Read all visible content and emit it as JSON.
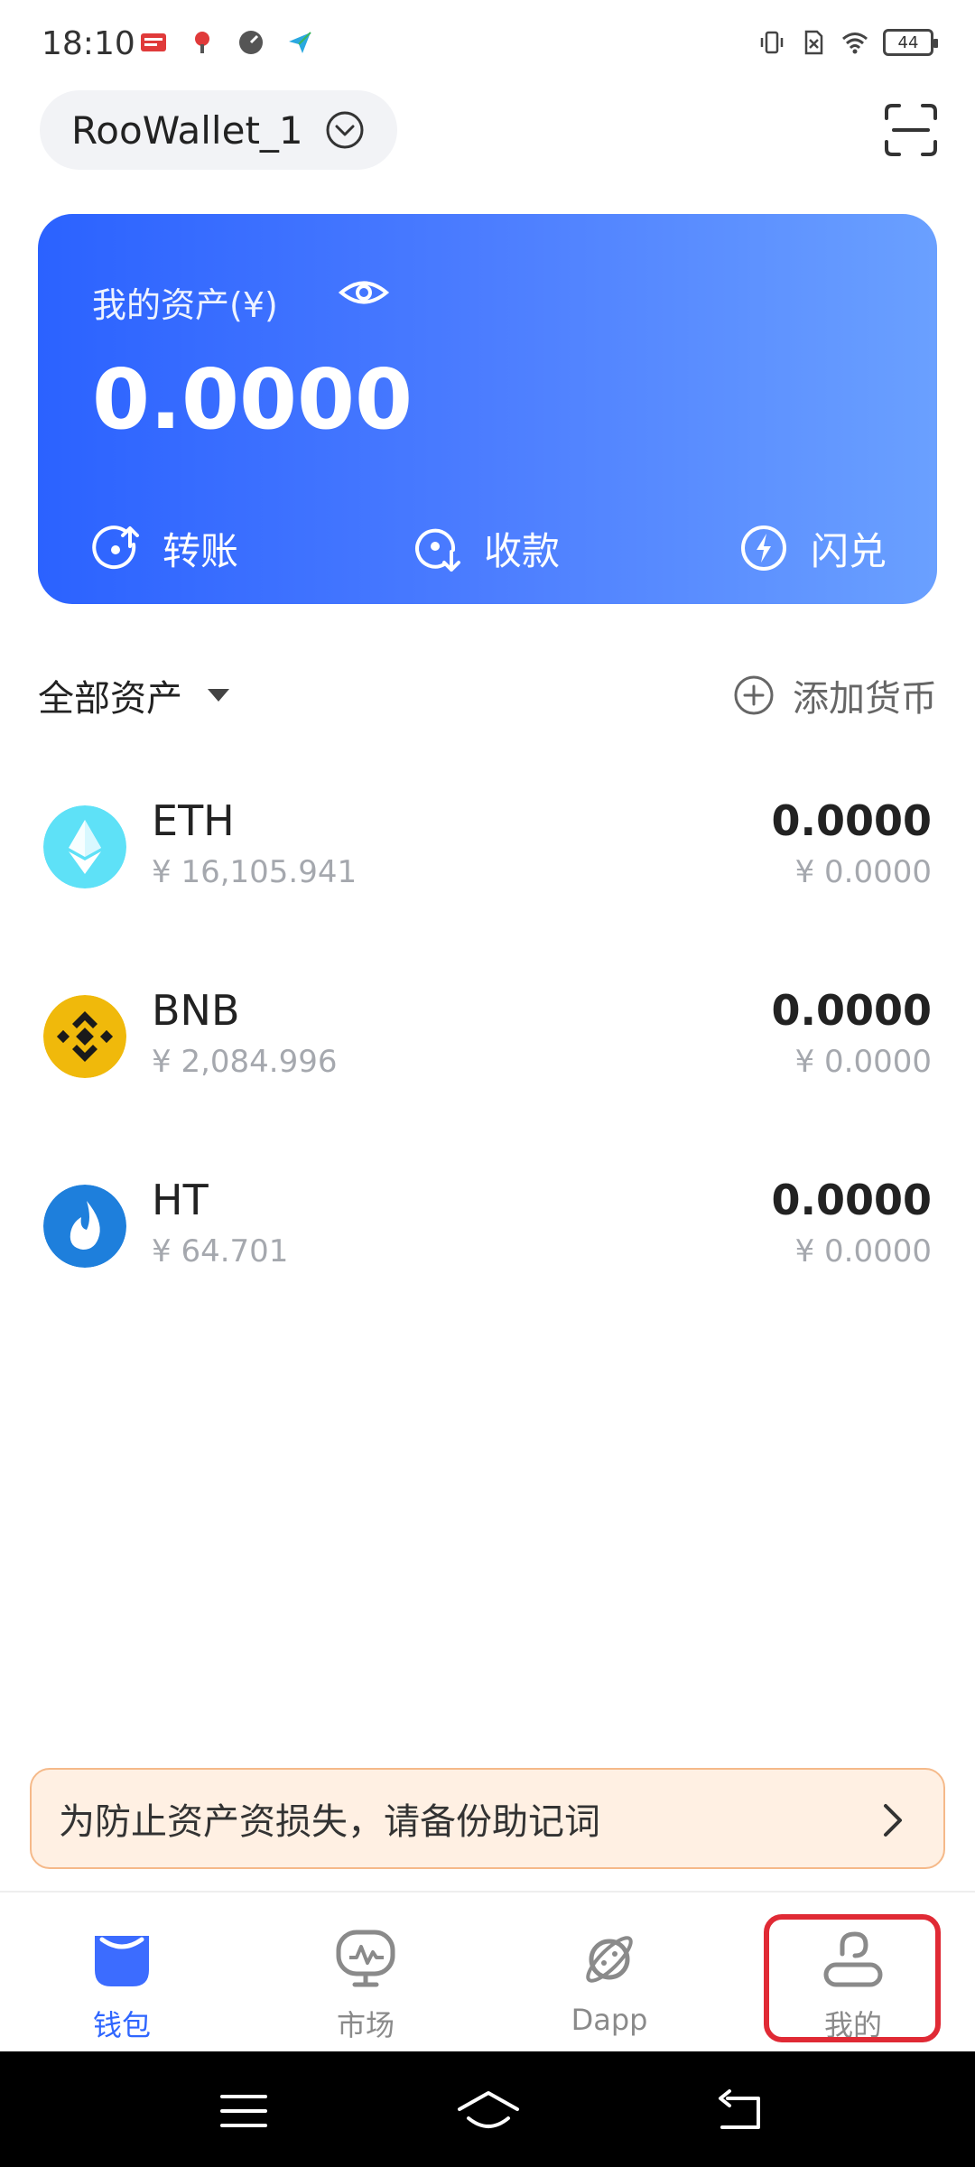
{
  "status_bar": {
    "time": "18:10",
    "battery": "44",
    "left_icons": [
      "toutiao-icon",
      "map-pin-icon",
      "speedometer-icon",
      "send-icon"
    ],
    "right_icons": [
      "vibrate-icon",
      "no-sim-icon",
      "wifi-icon",
      "battery-icon"
    ]
  },
  "header": {
    "wallet_name": "RooWallet_1",
    "chevron_icon": "chevron-down-circle-icon",
    "scan_icon": "scan-icon"
  },
  "asset_card": {
    "title": "我的资产(¥)",
    "total": "0.0000",
    "actions": [
      {
        "label": "转账",
        "icon": "transfer-icon"
      },
      {
        "label": "收款",
        "icon": "receive-icon"
      },
      {
        "label": "闪兑",
        "icon": "flash-swap-icon"
      }
    ],
    "gradient_start": "#2b62ff",
    "gradient_end": "#6aa0ff"
  },
  "assets_section": {
    "title": "全部资产",
    "add_label": "添加货币"
  },
  "tokens": [
    {
      "symbol": "ETH",
      "price": "¥ 16,105.941",
      "amount": "0.0000",
      "value": "¥ 0.0000",
      "icon_color": "#5ee1f7"
    },
    {
      "symbol": "BNB",
      "price": "¥ 2,084.996",
      "amount": "0.0000",
      "value": "¥ 0.0000",
      "icon_color": "#f0b90b"
    },
    {
      "symbol": "HT",
      "price": "¥ 64.701",
      "amount": "0.0000",
      "value": "¥ 0.0000",
      "icon_color": "#1e7fdc"
    }
  ],
  "backup_notice": {
    "text": "为防止资产资损失，请备份助记词"
  },
  "bottom_nav": [
    {
      "label": "钱包",
      "icon": "wallet-icon",
      "active": true
    },
    {
      "label": "市场",
      "icon": "market-icon",
      "active": false
    },
    {
      "label": "Dapp",
      "icon": "planet-icon",
      "active": false
    },
    {
      "label": "我的",
      "icon": "profile-icon",
      "active": false
    }
  ],
  "colors": {
    "accent": "#2f66ff",
    "highlight": "#e02a35",
    "notice_bg": "#fff0e3"
  }
}
